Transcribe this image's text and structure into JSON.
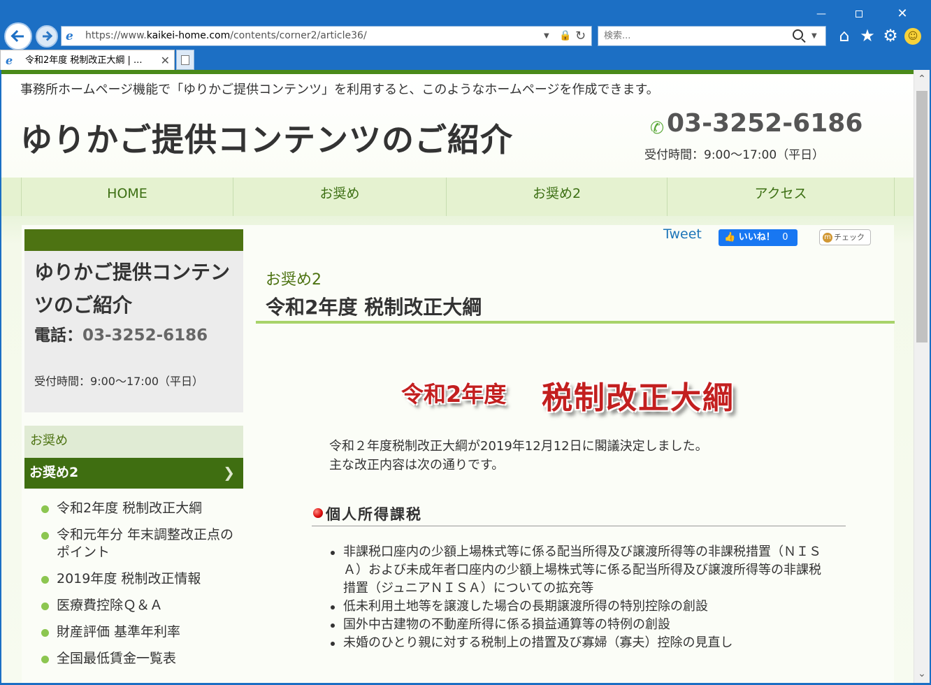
{
  "browser": {
    "url_prefix": "https://www.",
    "url_domain": "kaikei-home.com",
    "url_path": "/contents/corner2/article36/",
    "search_placeholder": "検索...",
    "tab_title": "令和2年度 税制改正大綱 | ...",
    "scroll_position": 0.0
  },
  "header": {
    "notice": "事務所ホームページ機能で「ゆりかご提供コンテンツ」を利用すると、このようなホームページを作成できます。",
    "site_title": "ゆりかご提供コンテンツのご紹介",
    "phone": "03-3252-6186",
    "hours": "受付時間：9:00〜17:00（平日）"
  },
  "nav": {
    "items": [
      "HOME",
      "お奨め",
      "お奨め2",
      "アクセス"
    ]
  },
  "sidebar": {
    "title": "ゆりかご提供コンテンツのご紹介",
    "phone_label": "電話：",
    "phone": "03-3252-6186",
    "hours_label": "受付時間：",
    "hours_value": "9:00〜17:00（平日）",
    "menu_rec": "お奨め",
    "menu_rec2": "お奨め2",
    "links": [
      "令和2年度 税制改正大綱",
      "令和元年分 年末調整改正点のポイント",
      "2019年度 税制改正情報",
      "医療費控除Ｑ＆Ａ",
      "財産評価 基準年利率",
      "全国最低賃金一覧表"
    ]
  },
  "social": {
    "tweet": "Tweet",
    "like": "いいね！",
    "like_count": "0",
    "check": "チェック"
  },
  "article": {
    "category": "お奨め2",
    "title": "令和2年度 税制改正大綱",
    "banner_year": "令和2年度",
    "banner_main": "税制改正大綱",
    "intro_line1": "令和２年度税制改正大綱が2019年12月12日に閣議決定しました。",
    "intro_line2": "主な改正内容は次の通りです。",
    "section_title": "個人所得課税",
    "bullets": [
      "非課税口座内の少額上場株式等に係る配当所得及び譲渡所得等の非課税措置（ＮＩＳＡ）および未成年者口座内の少額上場株式等に係る配当所得及び譲渡所得等の非課税措置（ジュニアＮＩＳＡ）についての拡充等",
      "低未利用土地等を譲渡した場合の長期譲渡所得の特別控除の創設",
      "国外中古建物の不動産所得に係る損益通算等の特例の創設",
      "未婚のひとり親に対する税制上の措置及び寡婦（寡夫）控除の見直し"
    ]
  },
  "colors": {
    "accent_green": "#4d7312",
    "nav_bg": "#e5f2d0",
    "banner_red": "#c31f1f",
    "browser_blue": "#1c6fc4"
  }
}
